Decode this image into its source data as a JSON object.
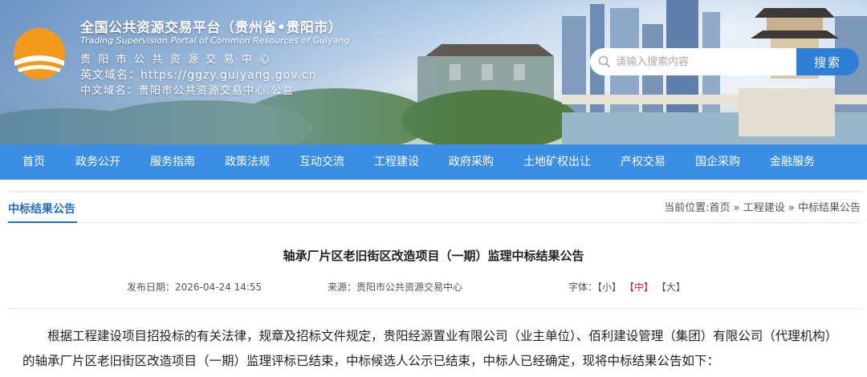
{
  "header": {
    "title": "全国公共资源交易平台（贵州省•贵阳市）",
    "subtitle_en": "Trading Supervision Portal of Common Resources of Guiyang",
    "center_name": "贵阳市公共资源交易中心",
    "en_domain_label": "英文域名：",
    "en_domain": "https://ggzy.guiyang.gov.cn",
    "cn_domain_label": "中文域名：",
    "cn_domain": "贵阳市公共资源交易中心.公益"
  },
  "search": {
    "placeholder": "请输入搜索内容",
    "button_label": "搜索"
  },
  "nav": {
    "items": [
      {
        "label": "首页"
      },
      {
        "label": "政务公开"
      },
      {
        "label": "服务指南"
      },
      {
        "label": "政策法规"
      },
      {
        "label": "互动交流"
      },
      {
        "label": "工程建设"
      },
      {
        "label": "政府采购"
      },
      {
        "label": "土地矿权出让"
      },
      {
        "label": "产权交易"
      },
      {
        "label": "国企采购"
      },
      {
        "label": "金融服务"
      }
    ]
  },
  "section": {
    "title": "中标结果公告"
  },
  "breadcrumb": {
    "prefix": "当前位置:",
    "items": [
      "首页",
      "工程建设",
      "中标结果公告"
    ],
    "separator": "»"
  },
  "article": {
    "title": "轴承厂片区老旧街区改造项目（一期）监理中标结果公告",
    "date_label": "发布日期：",
    "date": "2026-04-24 14:55",
    "source_label": "来源：",
    "source": "贵阳市公共资源交易中心",
    "font_label": "字体：",
    "font_small": "【小】",
    "font_medium": "【中】",
    "font_large": "【大】",
    "body": "根据工程建设项目招投标的有关法律，规章及招标文件规定，贵阳经源置业有限公司（业主单位）、佰利建设管理（集团）有限公司（代理机构）的轴承厂片区老旧街区改造项目（一期）监理评标已结束，中标候选人公示已结束，中标人已经确定，现将中标结果公告如下："
  },
  "colors": {
    "nav_bg": "#3b8ee5",
    "accent": "#1f6fc5",
    "search_button": "#2f7fd6",
    "active_font": "#e02020"
  }
}
